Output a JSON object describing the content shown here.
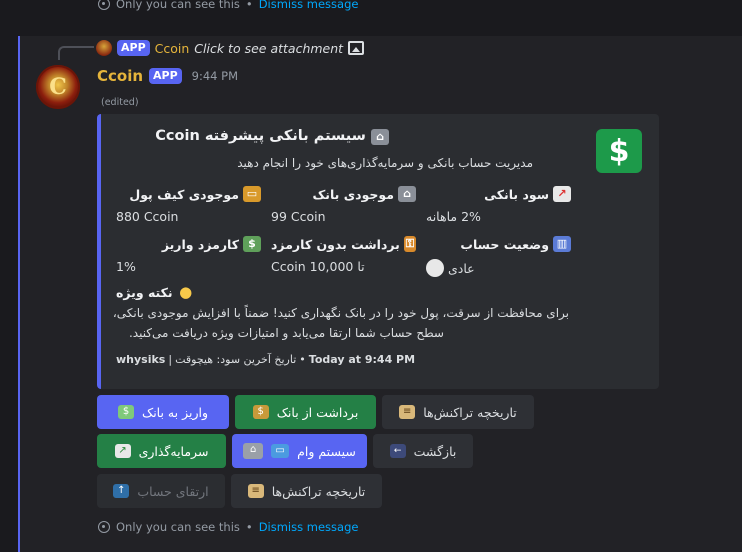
{
  "ephemeral": {
    "top_text": "Only you can see this",
    "dot": "•",
    "dismiss": "Dismiss message",
    "bottom_text": "Only you can see this"
  },
  "reply": {
    "app_badge": "APP",
    "author": "Ccoin",
    "text": "Click to see attachment"
  },
  "message": {
    "author": "Ccoin",
    "app_badge": "APP",
    "time": "9:44 PM",
    "edited": "(edited)",
    "avatar_letter": "C"
  },
  "embed": {
    "title": "سیستم بانکی پیشرفته Ccoin",
    "title_icon": "bank-icon",
    "description": "مدیریت حساب بانکی و سرمایه‌گذاری‌های خود را انجام دهید",
    "thumbnail_symbol": "$",
    "fields": [
      {
        "name": "موجودی کیف پول",
        "value": "880 Ccoin",
        "icon": "credit-card-icon"
      },
      {
        "name": "موجودی بانک",
        "value": "99 Ccoin",
        "icon": "bank-icon"
      },
      {
        "name": "سود بانکی",
        "value": "2% ماهانه",
        "icon": "chart-up-icon"
      },
      {
        "name": "کارمزد واریز",
        "value": "1%",
        "icon": "money-wings-icon"
      },
      {
        "name": "برداشت بدون کارمزد",
        "value": "تا 10,000 Ccoin",
        "icon": "lock-key-icon"
      },
      {
        "name": "وضعیت حساب",
        "value": "عادی",
        "icon": "bar-chart-icon"
      }
    ],
    "note": {
      "name": "نکته ویژه",
      "line1": "برای محافظت از سرقت، پول خود را در بانک نگهداری کنید! ضمناً با افزایش موجودی بانکی،",
      "line2": "سطح حساب شما ارتقا می‌یابد و امتیازات ویژه دریافت می‌کنید."
    },
    "footer": {
      "author": "whysiks",
      "last_profit": "تاریخ آخرین سود: هیچوقت",
      "time": "Today at 9:44 PM"
    }
  },
  "buttons": {
    "deposit": "واریز به بانک",
    "withdraw": "برداشت از بانک",
    "history1": "تاریخچه تراکنش‌ها",
    "invest": "سرمایه‌گذاری",
    "loan": "سیستم وام",
    "back": "بازگشت",
    "upgrade": "ارتقای حساب",
    "history2": "تاریخچه تراکنش‌ها"
  },
  "colors": {
    "accent": "#5865f2",
    "gold": "#e6b53b",
    "green": "#248046",
    "link": "#00a8fc"
  }
}
